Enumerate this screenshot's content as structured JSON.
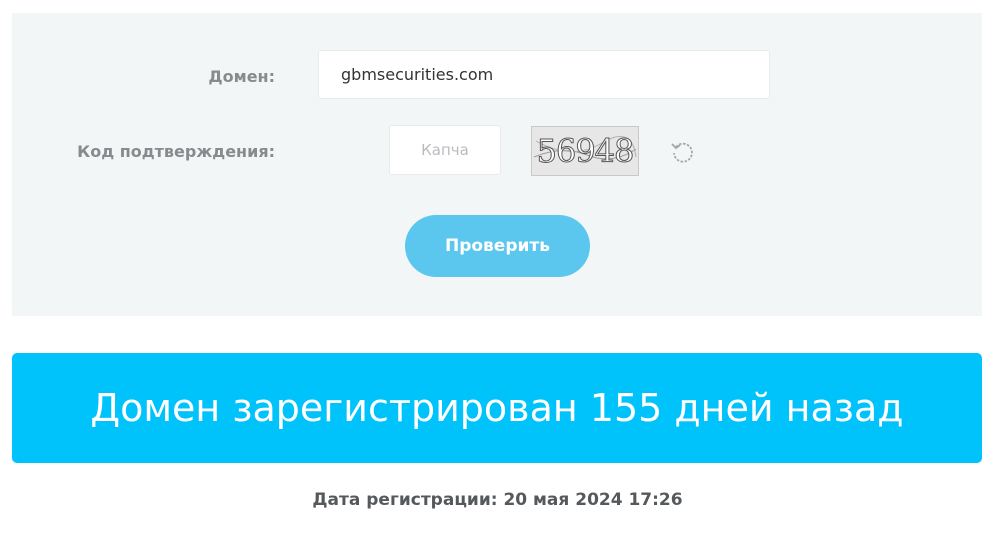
{
  "form": {
    "domain_label": "Домен:",
    "domain_value": "gbmsecurities.com",
    "captcha_label": "Код подтверждения:",
    "captcha_placeholder": "Капча",
    "captcha_value": "",
    "captcha_image_text": "56948",
    "refresh_icon": "refresh-icon",
    "submit_label": "Проверить"
  },
  "result": {
    "headline": "Домен зарегистрирован 155 дней назад",
    "registration_line": "Дата регистрации: 20 мая 2024 17:26"
  },
  "colors": {
    "panel_bg": "#f3f6f7",
    "button_bg": "#5bc7ef",
    "banner_bg": "#00c3fb",
    "label_text": "#888b8d"
  }
}
